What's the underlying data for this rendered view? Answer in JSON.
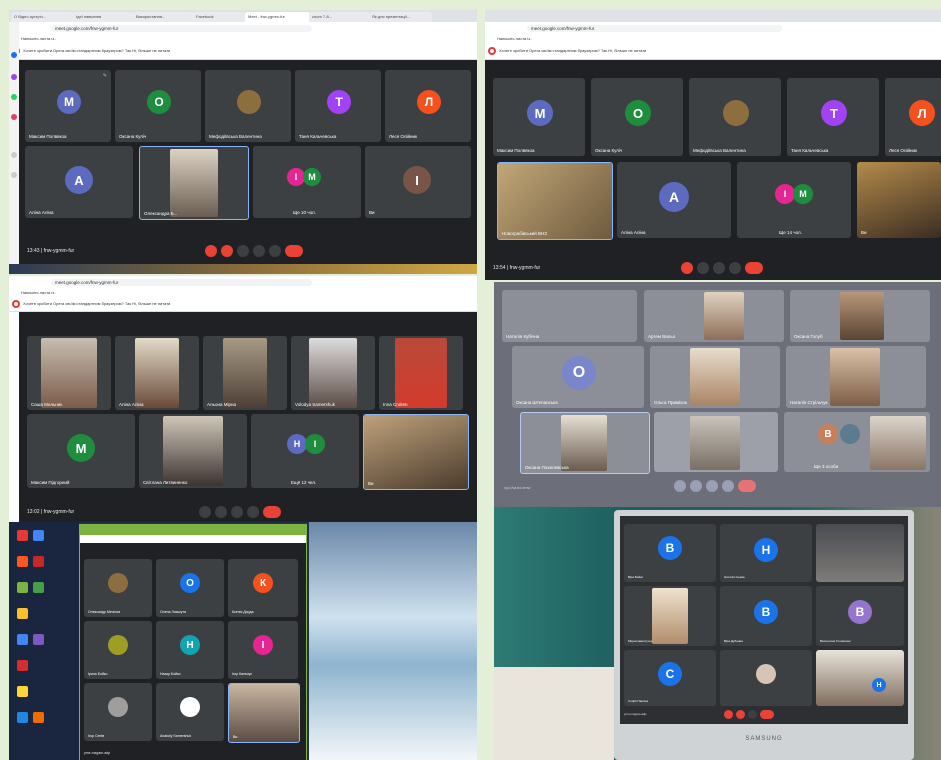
{
  "quad_tl": {
    "tabs": [
      "О Відео-зустріч...",
      "Ідеї навчання",
      "Використання...",
      "Facebook",
      "Meet - fnw-ygmm-fur",
      "zoom 7-8...",
      "Як для презентації..."
    ],
    "url": "meet.google.com/fnw-ygmm-fur",
    "bookmark": "Напишіть листа із..",
    "infobar": "Хочете зробити Opera своїм стандартним браузером?   Так   Ні, більше не питати",
    "tiles": [
      {
        "name": "Максим Полвякоа",
        "letter": "М",
        "color": "#5c6bc0"
      },
      {
        "name": "Оксана Куліч",
        "letter": "О",
        "color": "#1e8e3e"
      },
      {
        "name": "Мефодіївська Валентина",
        "letter": "",
        "color": ""
      },
      {
        "name": "Таня Кальчевська",
        "letter": "Т",
        "color": "#a142f4"
      },
      {
        "name": "Леся Олійник",
        "letter": "Л",
        "color": "#f4511e"
      },
      {
        "name": "Аліна Аліна",
        "letter": "А",
        "color": "#5c6bc0"
      },
      {
        "name": "Олександра Б...",
        "letter": "",
        "color": ""
      },
      {
        "name": "Ще 10 чол.",
        "letter": "",
        "color": ""
      },
      {
        "name": "Ви",
        "letter": "І",
        "color": "#795548"
      }
    ],
    "time": "13:43",
    "code": "fnw-ygmm-fur"
  },
  "quad_tr": {
    "url": "meet.google.com/fnw-ygmm-fur",
    "bookmark": "Напишіть листа із..",
    "infobar": "Хочете зробити Opera своїм стандартним браузером?   Так   Ні, більше не питати",
    "tiles": [
      {
        "name": "Максим Полвякоа",
        "letter": "М",
        "color": "#5c6bc0"
      },
      {
        "name": "Оксана Куліч",
        "letter": "О",
        "color": "#1e8e3e"
      },
      {
        "name": "Мефодіївська Валентина",
        "letter": "",
        "color": ""
      },
      {
        "name": "Таня Кальчевська",
        "letter": "Т",
        "color": "#a142f4"
      },
      {
        "name": "Леся Олійник",
        "letter": "Л",
        "color": "#f4511e"
      },
      {
        "name": "Новограбівський ВНЗ",
        "letter": "",
        "color": ""
      },
      {
        "name": "Аліна Аліна",
        "letter": "А",
        "color": "#5c6bc0"
      },
      {
        "name": "Ще 14 чол.",
        "letter": "",
        "color": ""
      },
      {
        "name": "Ви",
        "letter": "",
        "color": ""
      }
    ],
    "time": "13:54",
    "code": "fnw-ygmm-fur"
  },
  "quad_ml": {
    "url": "meet.google.com/fnw-ygmm-fur",
    "bookmark": "Напишіть листа із..",
    "infobar": "Хочете зробити Opera своїм стандартним браузером?   Так   Ні, більше не питати",
    "tiles": [
      {
        "name": "Саша Мельник",
        "letter": "",
        "color": ""
      },
      {
        "name": "Аліна Аліна",
        "letter": "",
        "color": ""
      },
      {
        "name": "Альона Мірна",
        "letter": "",
        "color": ""
      },
      {
        "name": "Volodya Samershuk",
        "letter": "",
        "color": ""
      },
      {
        "name": "Inna Croiten",
        "letter": "",
        "color": ""
      },
      {
        "name": "Максим Підгорний",
        "letter": "М",
        "color": "#1e8e3e"
      },
      {
        "name": "Світлана Литвиненко",
        "letter": "",
        "color": ""
      },
      {
        "name": "Ещё 12 чел.",
        "letter": "",
        "color": ""
      },
      {
        "name": "Ви",
        "letter": "",
        "color": ""
      }
    ],
    "time": "13:02",
    "code": "fnw-ygmm-fur"
  },
  "quad_br_top": {
    "tiles": [
      {
        "name": "Наталія Кубічна",
        "letter": "",
        "color": ""
      },
      {
        "name": "Артем Вальо",
        "letter": "",
        "color": ""
      },
      {
        "name": "Оксана Голуб",
        "letter": "",
        "color": ""
      },
      {
        "name": "Оксана Штепанська",
        "letter": "О",
        "color": "#7986cb"
      },
      {
        "name": "Ольга Примісик",
        "letter": "",
        "color": ""
      },
      {
        "name": "Наталія Стрільчук",
        "letter": "",
        "color": ""
      },
      {
        "name": "Оксана Похилевська",
        "letter": "",
        "color": ""
      },
      {
        "name": "",
        "letter": "",
        "color": ""
      },
      {
        "name": "Ще 3 особи",
        "letter": "В",
        "color": "#c9805a"
      }
    ],
    "code": "xyz-fwuhl-nmw"
  },
  "quad_bl": {
    "tiles": [
      {
        "name": "Олександр Мечілов",
        "letter": "",
        "color": ""
      },
      {
        "name": "Олена Лязькута",
        "letter": "О",
        "color": "#1a73e8"
      },
      {
        "name": "Ксенія Дорда",
        "letter": "К",
        "color": "#f4511e"
      },
      {
        "name": "Ірина Бойко",
        "letter": "",
        "color": ""
      },
      {
        "name": "Назар Бойко",
        "letter": "Н",
        "color": "#12a4af"
      },
      {
        "name": "Ігор Кальчук",
        "letter": "І",
        "color": "#e52592"
      },
      {
        "name": "Ігор Сенів",
        "letter": "",
        "color": ""
      },
      {
        "name": "Anatoliy Samershuk",
        "letter": "",
        "color": ""
      },
      {
        "name": "Ви",
        "letter": "",
        "color": ""
      }
    ],
    "code": "ymx-mzgam-adp"
  },
  "quad_br_monitor": {
    "brand": "SAMSUNG",
    "tiles": [
      {
        "name": "Віра Бойко",
        "letter": "В",
        "color": "#1a73e8"
      },
      {
        "name": "Наталія Ільєва",
        "letter": "Н",
        "color": "#1a73e8"
      },
      {
        "name": "",
        "letter": "",
        "color": ""
      },
      {
        "name": "Мирослава Кучер",
        "letter": "",
        "color": ""
      },
      {
        "name": "Віра Дубнова",
        "letter": "В",
        "color": "#1a73e8"
      },
      {
        "name": "Валентина Головатюк",
        "letter": "В",
        "color": "#9575cd"
      },
      {
        "name": "Софія Павлюк",
        "letter": "С",
        "color": "#1a73e8"
      },
      {
        "name": "",
        "letter": "",
        "color": ""
      },
      {
        "name": "",
        "letter": "Н",
        "color": "#1a73e8"
      }
    ],
    "code": "ymx-mzgam-adp"
  }
}
